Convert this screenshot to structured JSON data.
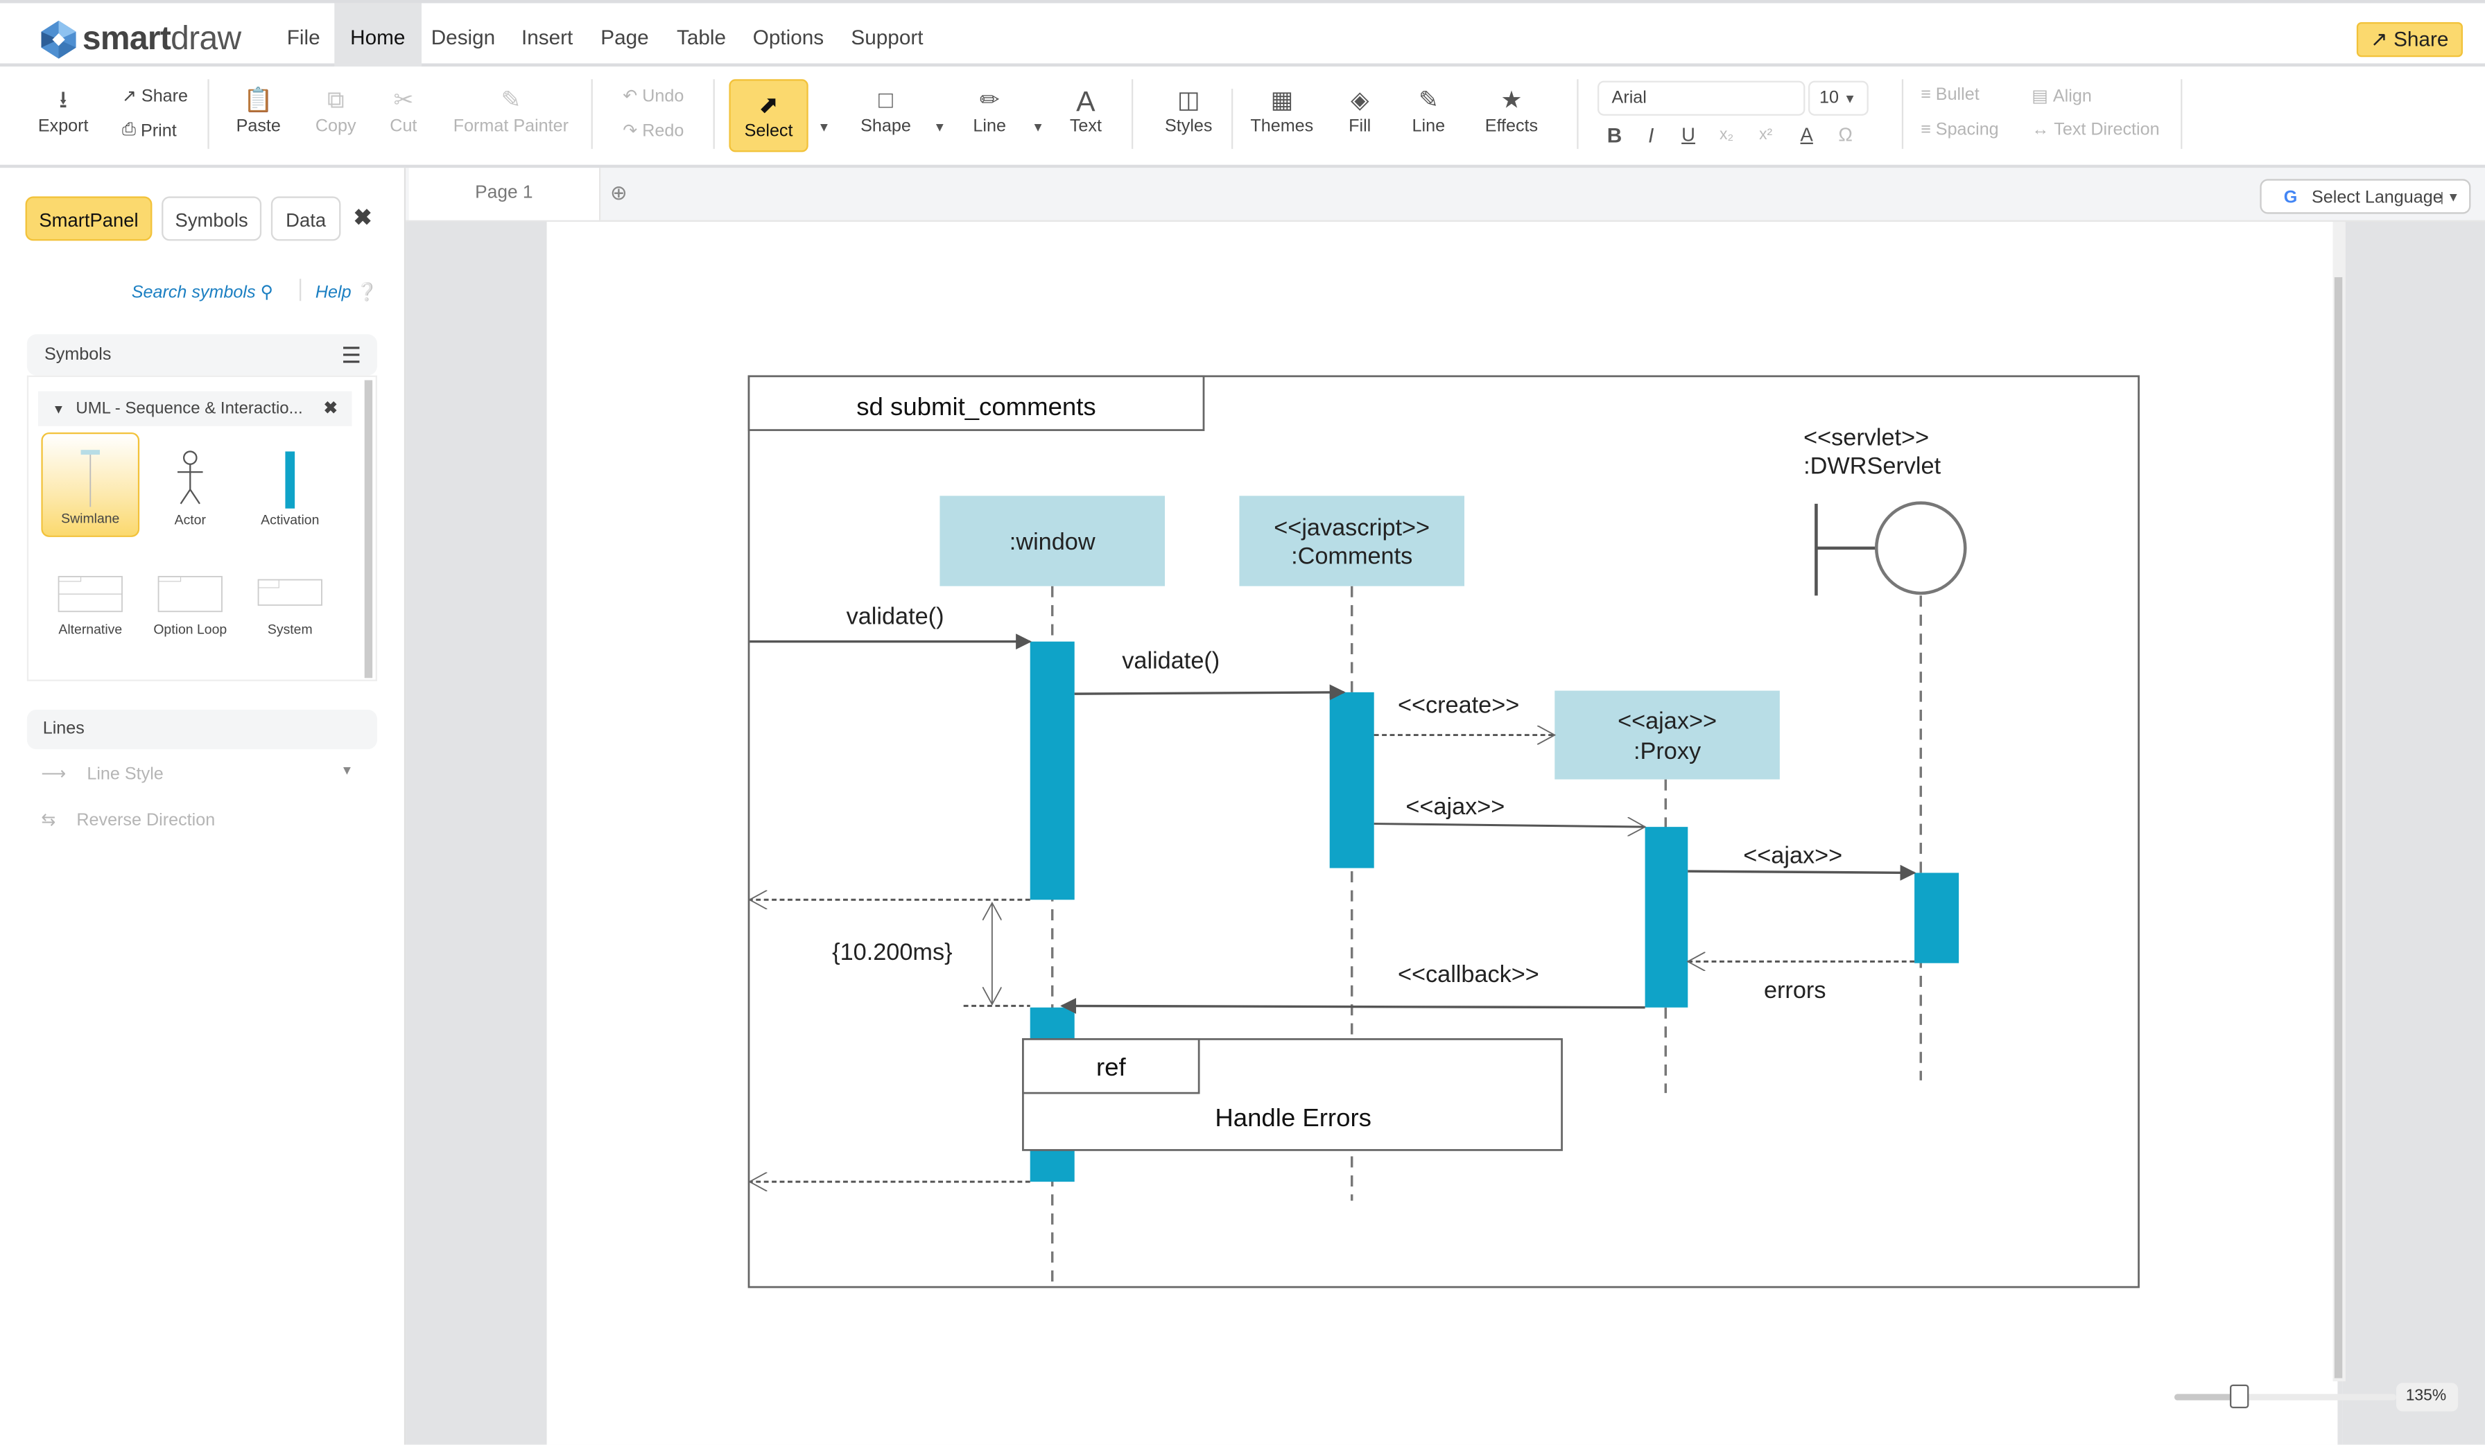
{
  "app": {
    "brand_bold": "smart",
    "brand_light": "draw"
  },
  "menu": [
    {
      "label": "File",
      "active": false
    },
    {
      "label": "Home",
      "active": true
    },
    {
      "label": "Design",
      "active": false
    },
    {
      "label": "Insert",
      "active": false
    },
    {
      "label": "Page",
      "active": false
    },
    {
      "label": "Table",
      "active": false
    },
    {
      "label": "Options",
      "active": false
    },
    {
      "label": "Support",
      "active": false
    }
  ],
  "share_button": {
    "label": "Share",
    "icon": "share-icon"
  },
  "ribbon": {
    "export": "Export",
    "share": "Share",
    "print": "Print",
    "paste": "Paste",
    "copy": "Copy",
    "cut": "Cut",
    "format_painter": "Format Painter",
    "undo": "Undo",
    "redo": "Redo",
    "select": "Select",
    "shape": "Shape",
    "line": "Line",
    "text": "Text",
    "styles": "Styles",
    "themes": "Themes",
    "fill": "Fill",
    "line2": "Line",
    "effects": "Effects",
    "font_name": "Arial",
    "font_size": "10",
    "bullet": "Bullet",
    "align": "Align",
    "spacing": "Spacing",
    "text_direction": "Text Direction"
  },
  "left_panel": {
    "tabs": [
      {
        "label": "SmartPanel",
        "active": true
      },
      {
        "label": "Symbols",
        "active": false
      },
      {
        "label": "Data",
        "active": false
      }
    ],
    "search_link": "Search symbols",
    "help_link": "Help",
    "symbols_header": "Symbols",
    "library_name": "UML - Sequence & Interactio...",
    "symbols": [
      {
        "label": "Swimlane",
        "active": true
      },
      {
        "label": "Actor",
        "active": false
      },
      {
        "label": "Activation",
        "active": false
      },
      {
        "label": "Alternative",
        "active": false
      },
      {
        "label": "Option Loop",
        "active": false
      },
      {
        "label": "System",
        "active": false
      }
    ],
    "lines_header": "Lines",
    "line_style": "Line Style",
    "reverse_direction": "Reverse Direction"
  },
  "page_tabs": [
    {
      "label": "Page 1",
      "active": true
    }
  ],
  "language_select": {
    "label": "Select Language"
  },
  "zoom": {
    "label": "135%",
    "value_percent": 135
  },
  "diagram": {
    "frame_title": "sd submit_comments",
    "lifelines": {
      "window": ":window",
      "comments_stereo": "<<javascript>>",
      "comments_name": ":Comments",
      "proxy_stereo": "<<ajax>>",
      "proxy_name": ":Proxy",
      "servlet_stereo": "<<servlet>>",
      "servlet_name": ":DWRServlet"
    },
    "messages": {
      "m1": "validate()",
      "m2": "validate()",
      "m3": "<<create>>",
      "m4": "<<ajax>>",
      "m5": "<<ajax>>",
      "m6": "errors",
      "m7": "<<callback>>"
    },
    "duration": "{10.200ms}",
    "ref_label": "ref",
    "ref_text": "Handle Errors",
    "colors": {
      "lifeline_head": "#b8dde6",
      "activation": "#0fa3c8",
      "line": "#555555"
    }
  }
}
